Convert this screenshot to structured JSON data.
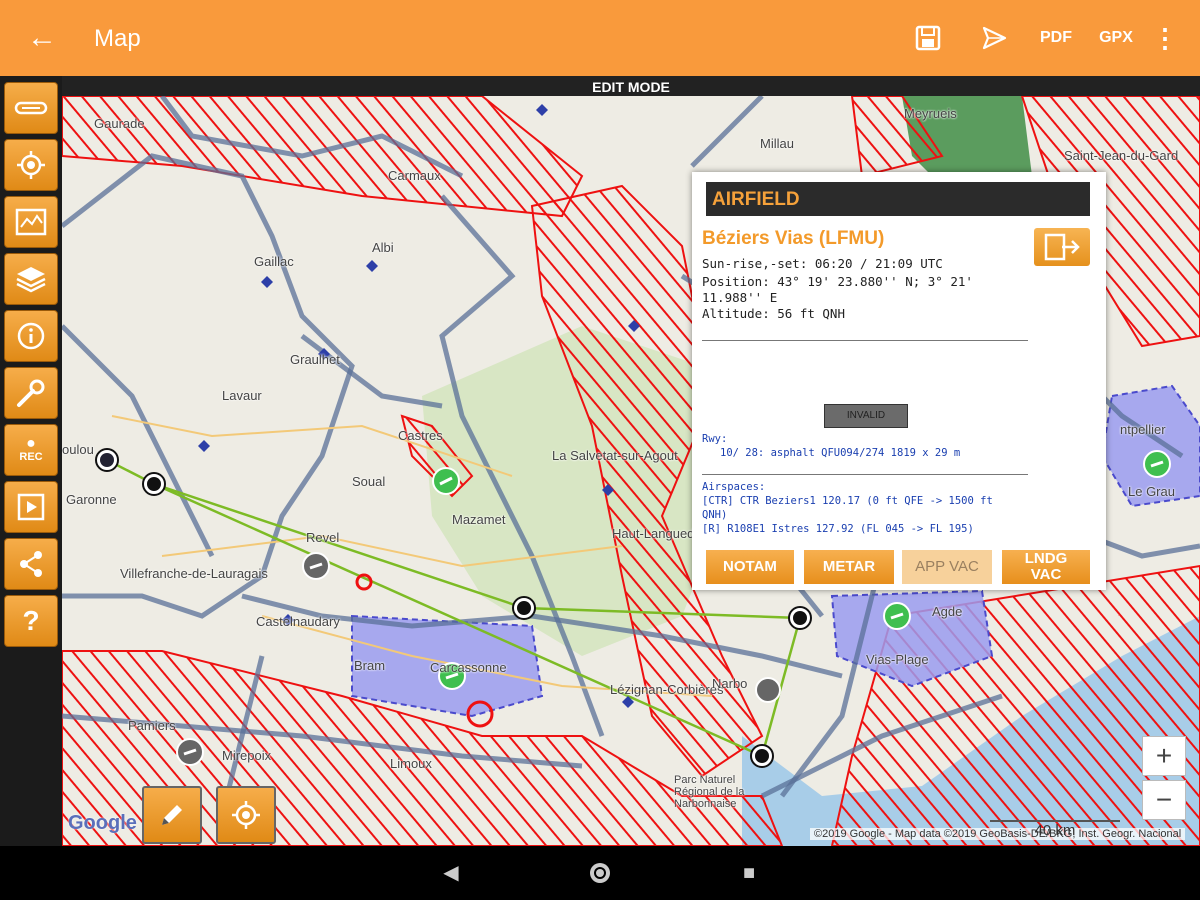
{
  "appbar": {
    "title": "Map",
    "pdf_label": "PDF",
    "gpx_label": "GPX"
  },
  "edit_mode_label": "EDIT MODE",
  "sidebar": {
    "rec_label": "REC",
    "help_label": "?"
  },
  "map_labels": {
    "gaurade": "Gaurade",
    "millau": "Millau",
    "meyrueis": "Meyrueis",
    "saint_jean": "Saint-Jean-du-Gard",
    "carmaux": "Carmaux",
    "gaillac": "Gaillac",
    "albi": "Albi",
    "graulhet": "Graulhet",
    "lavaur": "Lavaur",
    "castres": "Castres",
    "soual": "Soual",
    "mazamet": "Mazamet",
    "revel": "Revel",
    "toulouse": "oulou",
    "garonne": "Garonne",
    "villefranche": "Villefranche-de-Lauragais",
    "castelnaudary": "Castelnaudary",
    "bram": "Bram",
    "carcassonne": "Carcassonne",
    "pamiers": "Pamiers",
    "mirepoix": "Mirepoix",
    "limoux": "Limoux",
    "lezignan": "Lézignan-Corbières",
    "narbonne": "Narbo",
    "montpellier": "ntpellier",
    "agde": "Agde",
    "la_salvetat": "La Salvetat-sur-Agout",
    "haut_languedoc": "Haut-Languedoc",
    "narbonnaise": "Parc Naturel Régional de la Narbonnaise",
    "sete": "Le Grau",
    "vias_plage": "Vias-Plage"
  },
  "panel": {
    "header": "AIRFIELD",
    "name": "Béziers Vias (LFMU)",
    "sun": "Sun-rise,-set: 06:20 / 21:09 UTC",
    "position_1": "Position: 43° 19' 23.880'' N; 3° 21'",
    "position_2": "11.988'' E",
    "altitude": "Altitude: 56 ft QNH",
    "invalid_label": "INVALID",
    "rwy_title": "Rwy:",
    "rwy_line": "10/ 28: asphalt QFU094/274 1819 x 29 m",
    "airspaces_title": "Airspaces:",
    "airspace_1": "[CTR] CTR Beziers1 120.17 (0 ft QFE -> 1500 ft",
    "airspace_1b": "QNH)",
    "airspace_2": "[R] R108E1 Istres 127.92 (FL 045 -> FL 195)",
    "btn_notam": "NOTAM",
    "btn_metar": "METAR",
    "btn_app_vac": "APP VAC",
    "btn_lndg_1": "LNDG",
    "btn_lndg_2": "VAC"
  },
  "zoom": {
    "in": "+",
    "out": "−"
  },
  "google_label": "Google",
  "attribution": "©2019 Google - Map data ©2019 GeoBasis-DE/BKG, Inst. Geogr. Nacional",
  "scale_label": "40 km",
  "colors": {
    "accent": "#f99a3c",
    "restricted": "#ee1111",
    "airspace_border": "#5a7098",
    "route": "#7dbb25",
    "ctr_fill": "#9a9cf0"
  }
}
